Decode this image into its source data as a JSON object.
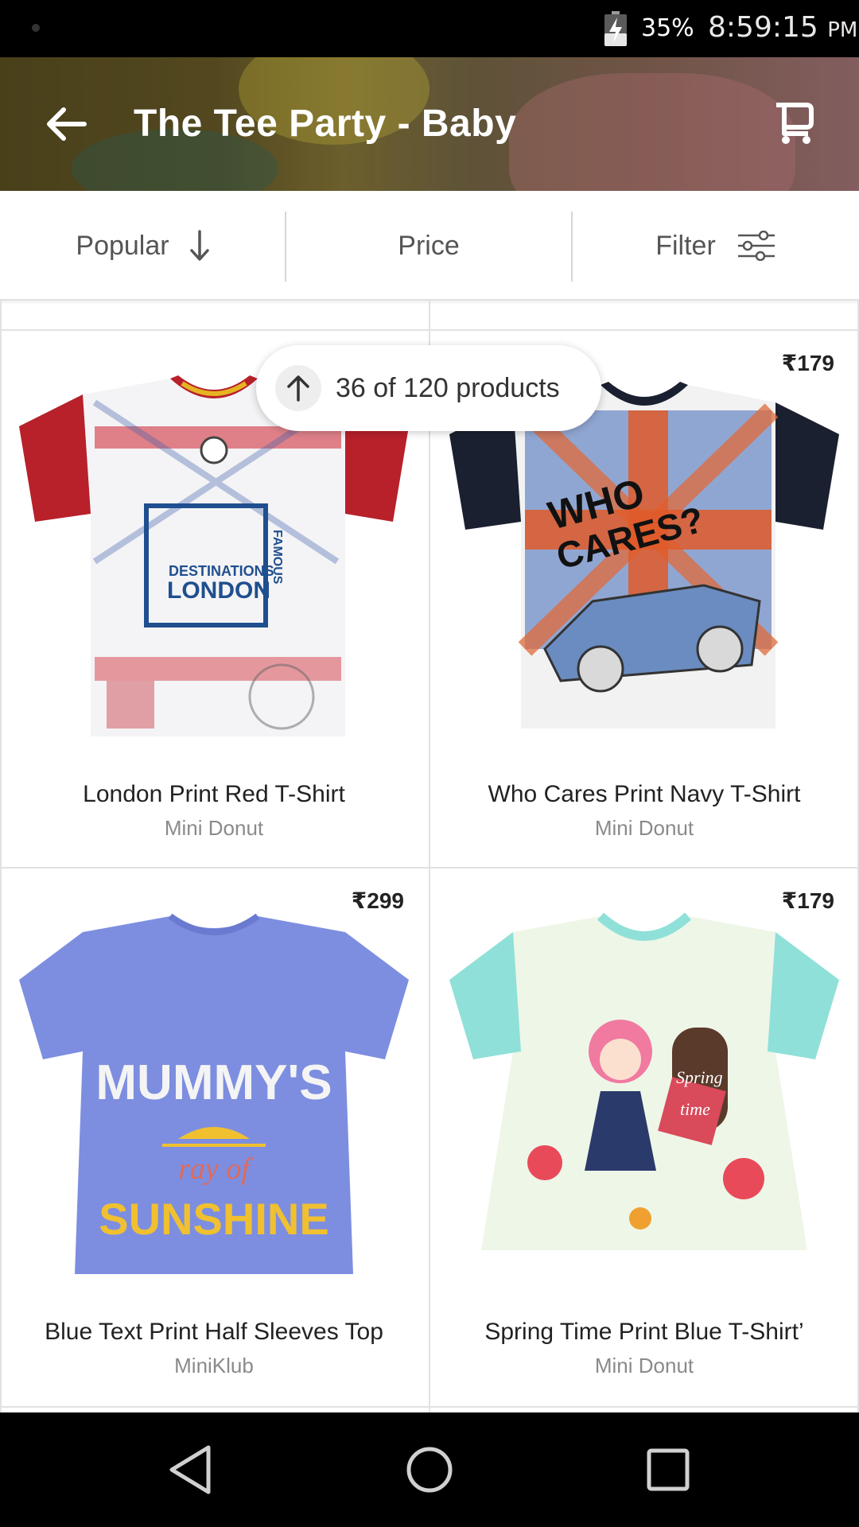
{
  "status_bar": {
    "battery": "35%",
    "time": "8:59:15",
    "ampm": "PM"
  },
  "header": {
    "title": "The Tee Party - Baby"
  },
  "toolbar": {
    "sort_label": "Popular",
    "price_label": "Price",
    "filter_label": "Filter"
  },
  "product_count": {
    "text": "36 of 120 products"
  },
  "products": [
    {
      "name": "London Print Red T-Shirt",
      "brand": "Mini Donut",
      "price": ""
    },
    {
      "name": "Who Cares Print Navy T-Shirt",
      "brand": "Mini Donut",
      "price": "₹179"
    },
    {
      "name": "Blue Text Print Half Sleeves Top",
      "brand": "MiniKlub",
      "price": "₹299"
    },
    {
      "name": "Spring Time Print Blue T-Shirt’",
      "brand": "Mini Donut",
      "price": "₹179"
    }
  ],
  "shirt_text": {
    "london_line1": "DESTINATIONS",
    "london_line2": "LONDON",
    "london_vertical": "FAMOUS",
    "who_line1": "WHO",
    "who_line2": "CARES?",
    "mummy_line1": "MUMMY'S",
    "mummy_line2": "ray of",
    "mummy_line3": "SUNSHINE",
    "spring_line1": "Spring",
    "spring_line2": "time"
  },
  "colors": {
    "london_shirt": "#b8202a",
    "who_sleeves": "#1a2030",
    "mummy_shirt": "#7d8ee0",
    "spring_sleeves": "#8fe0d8"
  }
}
